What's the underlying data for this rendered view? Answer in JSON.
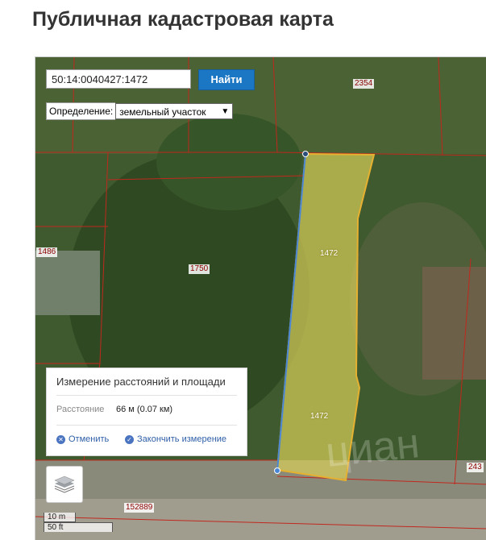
{
  "page": {
    "title": "Публичная кадастровая карта"
  },
  "search": {
    "value": "50:14:0040427:1472",
    "button_label": "Найти"
  },
  "definition": {
    "label": "Определение:",
    "selected": "земельный участок"
  },
  "parcels": [
    {
      "id": "2354"
    },
    {
      "id": "1486"
    },
    {
      "id": "1750"
    },
    {
      "id": "1472",
      "selected": true
    },
    {
      "id": "1472",
      "selected": true
    },
    {
      "id": "243"
    },
    {
      "id": "152889"
    }
  ],
  "measurement": {
    "title": "Измерение расстояний и площади",
    "distance_label": "Расстояние",
    "distance_value": "66 м (0.07 км)",
    "cancel_label": "Отменить",
    "finish_label": "Закончить измерение"
  },
  "scale": {
    "metric": "10 m",
    "imperial": "50 ft"
  },
  "colors": {
    "accent": "#1b76c4",
    "parcel_border": "#c0281e",
    "selected_fill": "#d8cf5a",
    "measure_line": "#4a86d6"
  }
}
